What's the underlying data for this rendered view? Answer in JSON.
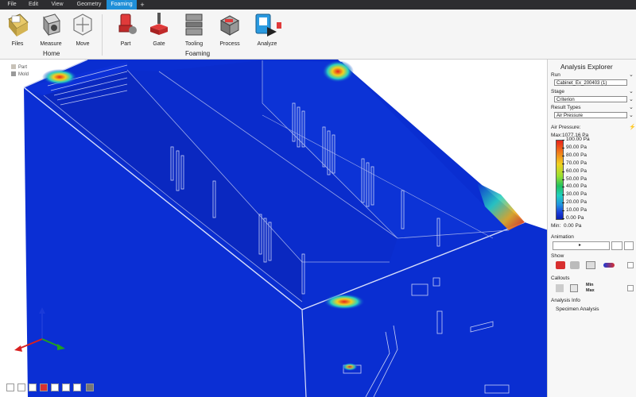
{
  "menu": {
    "items": [
      "File",
      "Edit",
      "View",
      "Geometry",
      "Foaming"
    ],
    "add_tab": "+"
  },
  "ribbon": {
    "home": {
      "group_label": "Home",
      "buttons": [
        "Files",
        "Measure",
        "Move"
      ]
    },
    "foaming": {
      "group_label": "Foaming",
      "buttons": [
        "Part",
        "Gate",
        "Tooling",
        "Process",
        "Analyze"
      ]
    }
  },
  "viewport": {
    "legend": [
      {
        "label": "Part",
        "color": "#c8c2b8"
      },
      {
        "label": "Mold",
        "color": "#9a9a9a"
      }
    ]
  },
  "analysis_explorer": {
    "title": "Analysis Explorer",
    "run_label": "Run",
    "run_value": "Cabinet_Ex_200403 (1)",
    "stage_label": "Stage",
    "stage_value": "Criterion",
    "result_types_label": "Result Types",
    "result_type_value": "Air Pressure",
    "colorbar": {
      "title": "Air Pressure:",
      "max_label": "Max:",
      "max_value": "1077.16 Pa",
      "min_label": "Min:",
      "ticks": [
        "100.00 Pa",
        "90.00 Pa",
        "80.00 Pa",
        "70.00 Pa",
        "60.00 Pa",
        "50.00 Pa",
        "40.00 Pa",
        "30.00 Pa",
        "20.00 Pa",
        "10.00 Pa",
        "0.00 Pa"
      ],
      "min_value": "0.00 Pa"
    },
    "animation_label": "Animation",
    "show_label": "Show",
    "callouts_label": "Callouts",
    "callouts_minmax": [
      "Min",
      "Max"
    ],
    "analysis_info_label": "Analysis Info",
    "analysis_info_value": "Specimen Analysis"
  },
  "colors": {
    "menubar": "#2d2d30",
    "active_tab": "#1f8fd8",
    "model_blue": "#0a2ed1",
    "hot": "#e8221b"
  },
  "icons": [
    "files-icon",
    "measure-icon",
    "move-icon",
    "part-icon",
    "gate-icon",
    "tooling-icon",
    "process-icon",
    "analyze-icon",
    "lightning-icon",
    "play-icon",
    "pencil-icon",
    "axis-triad-icon"
  ]
}
